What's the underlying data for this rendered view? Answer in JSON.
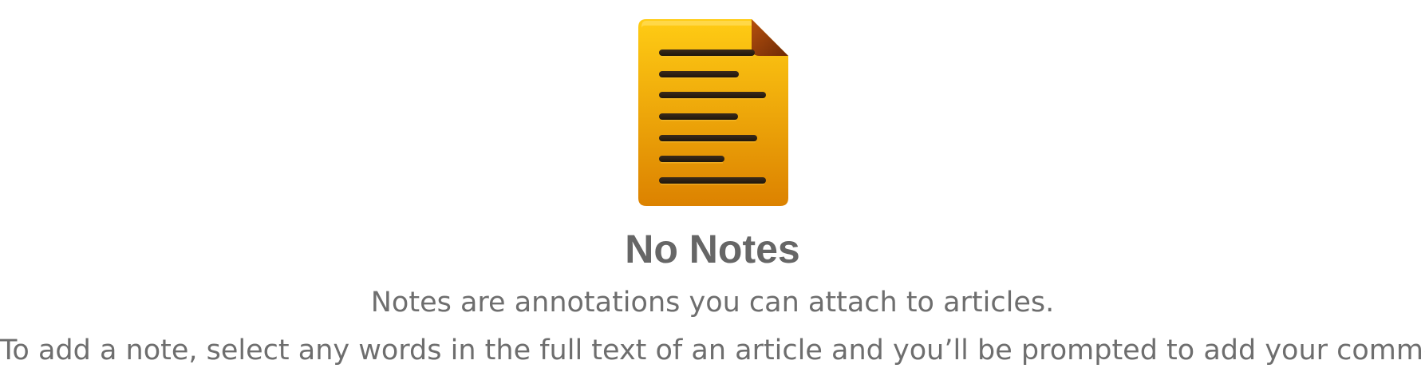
{
  "empty_state": {
    "icon": "note-document-icon",
    "title": "No Notes",
    "subtitle": "Notes are annotations you can attach to articles.",
    "instructions": "To add a note, select any words in the full text of an article and you’ll be prompted to add your comment."
  },
  "colors": {
    "icon_top": "#ffcc14",
    "icon_bottom": "#dc8200",
    "icon_lines": "#2d2116",
    "text": "#6e6e6e",
    "title": "#666666",
    "background": "#ffffff"
  }
}
